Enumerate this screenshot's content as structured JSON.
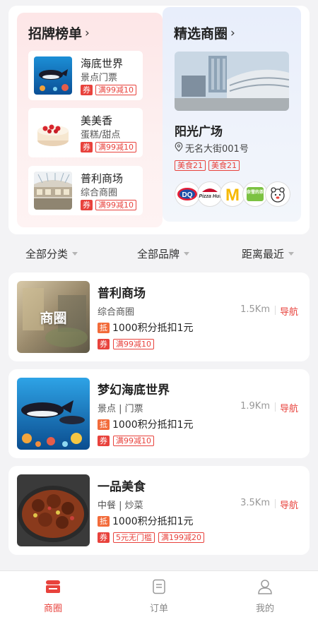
{
  "rank": {
    "title": "招牌榜单",
    "items": [
      {
        "name": "海底世界",
        "sub": "景点门票",
        "coupon_tag": "券",
        "coupon": "满99减10"
      },
      {
        "name": "美美香",
        "sub": "蛋糕/甜点",
        "coupon_tag": "券",
        "coupon": "满99减10"
      },
      {
        "name": "普利商场",
        "sub": "综合商圈",
        "coupon_tag": "券",
        "coupon": "满99减10"
      }
    ]
  },
  "circle": {
    "title": "精选商圈",
    "name": "阳光广场",
    "address": "无名大街001号",
    "tags": [
      "美食21",
      "美食21"
    ],
    "brands": [
      "DQ",
      "Pizza Hut",
      "M",
      "奈雪的茶",
      "bear"
    ]
  },
  "filters": [
    "全部分类",
    "全部品牌",
    "距离最近"
  ],
  "merchants": [
    {
      "image_label": "商圈",
      "name": "普利商场",
      "category": "综合商圈",
      "distance": "1.5Km",
      "nav": "导航",
      "points_tag": "抵",
      "points": "1000积分抵扣1元",
      "coupon_tag": "券",
      "coupons": [
        "满99减10"
      ]
    },
    {
      "image_label": "",
      "name": "梦幻海底世界",
      "category": "景点 | 门票",
      "distance": "1.9Km",
      "nav": "导航",
      "points_tag": "抵",
      "points": "1000积分抵扣1元",
      "coupon_tag": "券",
      "coupons": [
        "满99减10"
      ]
    },
    {
      "image_label": "",
      "name": "一品美食",
      "category": "中餐 | 炒菜",
      "distance": "3.5Km",
      "nav": "导航",
      "points_tag": "抵",
      "points": "1000积分抵扣1元",
      "coupon_tag": "券",
      "coupons": [
        "5元无门槛",
        "满199减20"
      ]
    }
  ],
  "tabs": [
    {
      "label": "商圈",
      "icon": "shop-circle-icon",
      "active": true
    },
    {
      "label": "订单",
      "icon": "order-icon",
      "active": false
    },
    {
      "label": "我的",
      "icon": "profile-icon",
      "active": false
    }
  ],
  "colors": {
    "accent": "#e8423c",
    "rank_bg": "#fde6e7",
    "circle_bg": "#e8eefb"
  }
}
